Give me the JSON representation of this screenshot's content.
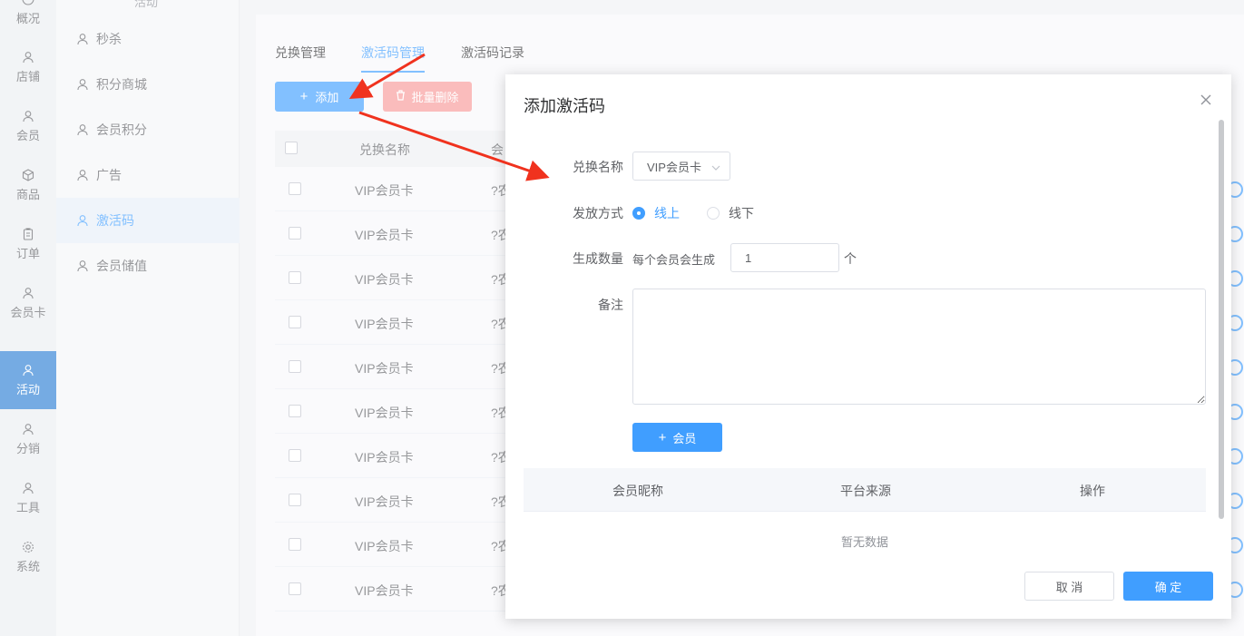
{
  "rail": {
    "items": [
      {
        "label": "概况",
        "icon": "dashboard-icon"
      },
      {
        "label": "店铺",
        "icon": "user-icon"
      },
      {
        "label": "会员",
        "icon": "user-icon"
      },
      {
        "label": "商品",
        "icon": "box-icon"
      },
      {
        "label": "订单",
        "icon": "clipboard-icon"
      },
      {
        "label": "会员卡",
        "icon": "user-icon"
      },
      {
        "label": "活动",
        "icon": "user-icon"
      },
      {
        "label": "分销",
        "icon": "user-icon"
      },
      {
        "label": "工具",
        "icon": "user-icon"
      },
      {
        "label": "系统",
        "icon": "gear-icon"
      }
    ],
    "active_index": 6,
    "active_color": "#2b7fd4"
  },
  "submenu": {
    "header": "活动",
    "items": [
      {
        "label": "秒杀"
      },
      {
        "label": "积分商城"
      },
      {
        "label": "会员积分"
      },
      {
        "label": "广告"
      },
      {
        "label": "激活码"
      },
      {
        "label": "会员储值"
      }
    ],
    "active_index": 4
  },
  "main": {
    "tabs": [
      {
        "label": "兑换管理"
      },
      {
        "label": "激活码管理"
      },
      {
        "label": "激活码记录"
      }
    ],
    "active_tab": 1,
    "add_button": "添加",
    "batch_delete_button": "批量删除",
    "table": {
      "headers": [
        "兑换名称",
        "会"
      ],
      "rows": [
        {
          "name": "VIP会员卡",
          "col2": "?农"
        },
        {
          "name": "VIP会员卡",
          "col2": "?农"
        },
        {
          "name": "VIP会员卡",
          "col2": "?农"
        },
        {
          "name": "VIP会员卡",
          "col2": "?农"
        },
        {
          "name": "VIP会员卡",
          "col2": "?农"
        },
        {
          "name": "VIP会员卡",
          "col2": "?农"
        },
        {
          "name": "VIP会员卡",
          "col2": "?农"
        },
        {
          "name": "VIP会员卡",
          "col2": "?农"
        },
        {
          "name": "VIP会员卡",
          "col2": "?农"
        },
        {
          "name": "VIP会员卡",
          "col2": "?农"
        }
      ]
    }
  },
  "dialog": {
    "title": "添加激活码",
    "fields": {
      "exchange_name_label": "兑换名称",
      "exchange_name_value": "VIP会员卡",
      "issue_method_label": "发放方式",
      "issue_options": [
        {
          "label": "线上",
          "checked": true
        },
        {
          "label": "线下",
          "checked": false
        }
      ],
      "quantity_label": "生成数量",
      "quantity_prefix": "每个会员会生成",
      "quantity_value": "1",
      "quantity_suffix": "个",
      "remark_label": "备注",
      "remark_value": ""
    },
    "add_member_button": "会员",
    "member_table": {
      "headers": [
        "会员昵称",
        "平台来源",
        "操作"
      ],
      "empty_text": "暂无数据"
    },
    "cancel_button": "取 消",
    "confirm_button": "确 定"
  },
  "colors": {
    "primary": "#409eff",
    "danger_light": "#f89898",
    "annotation_arrow": "#f0321e"
  }
}
